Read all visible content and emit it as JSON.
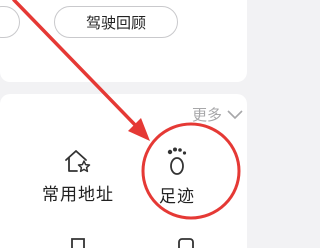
{
  "top_card": {
    "review_button_label": "驾驶回顾"
  },
  "section": {
    "more_label": "更多",
    "tiles": [
      {
        "label": "常用地址",
        "icon": "home-star-icon"
      },
      {
        "label": "足迹",
        "icon": "footprint-icon"
      }
    ]
  },
  "annotation": {
    "color": "#e53935",
    "shapes": [
      "arrow",
      "circle"
    ]
  }
}
